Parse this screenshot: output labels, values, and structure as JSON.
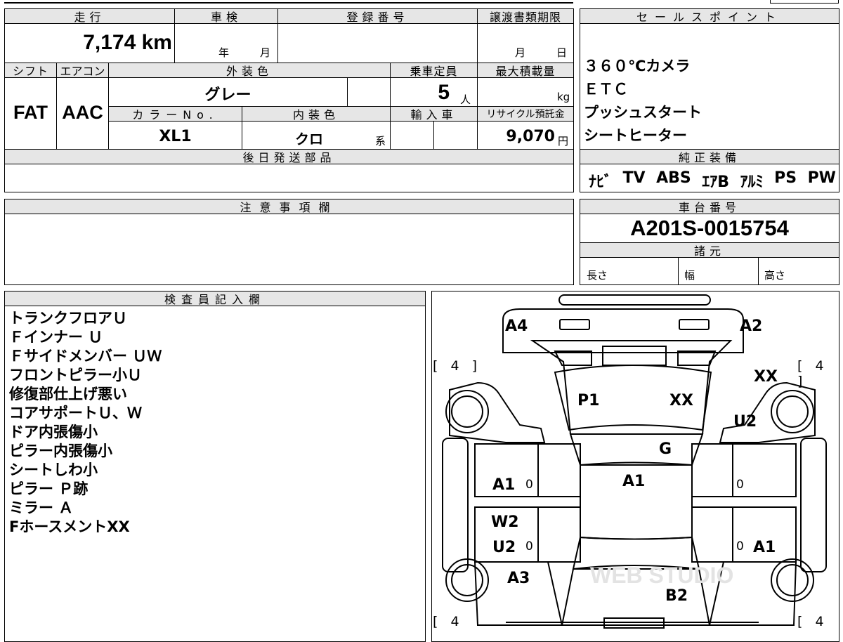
{
  "header": {
    "mileage_label": "走行",
    "inspection_label": "車検",
    "registration_label": "登録番号",
    "transfer_deadline_label": "譲渡書類期限",
    "sales_points_label": "セールスポイント"
  },
  "values": {
    "mileage": "7,174 km",
    "year_unit": "年",
    "month_unit": "月",
    "deadline_month": "月",
    "deadline_day": "日"
  },
  "labels": {
    "shift": "シフト",
    "aircon": "エアコン",
    "exterior_color": "外装色",
    "capacity": "乗車定員",
    "max_load": "最大積載量",
    "color_no": "カラーNo.",
    "interior_color": "内装色",
    "import": "輸入車",
    "recycle": "リサイクル預託金",
    "later_parts": "後日発送部品",
    "equipment": "純正装備",
    "notes": "注意事項欄",
    "chassis_no": "車台番号",
    "specs": "諸元",
    "length": "長さ",
    "width": "幅",
    "height": "高さ",
    "inspector": "検査員記入欄"
  },
  "specs_values": {
    "shift": "FAT",
    "aircon": "AAC",
    "exterior_color": "グレー",
    "capacity": "5",
    "capacity_unit": "人",
    "load_unit": "kg",
    "color_no": "XL1",
    "interior_color": "クロ",
    "interior_suffix": "系",
    "recycle_fee": "9,070",
    "recycle_unit": "円",
    "chassis_no": "A201S-0015754"
  },
  "sales_points": [
    "３６０℃カメラ",
    "ＥＴＣ",
    "プッシュスタート",
    "シートヒーター"
  ],
  "equipment": [
    "ﾅﾋﾞ",
    "TV",
    "ABS",
    "ｴｱB",
    "ｱﾙﾐ",
    "PS",
    "PW"
  ],
  "inspector_notes": [
    "トランクフロアＵ",
    "Ｆインナー Ｕ",
    "Ｆサイドメンバー ＵＷ",
    "フロントピラー小Ｕ",
    "修復部仕上げ悪い",
    "コアサポートＵ、Ｗ",
    "ドア内張傷小",
    "ピラー内張傷小",
    "シートしわ小",
    "ピラー Ｐ跡",
    "ミラー Ａ",
    "FホースメントXX"
  ],
  "diagram": {
    "tire_left_top": "[ 4 ]",
    "tire_right_top": "[ 4 ]",
    "tire_left_bottom": "[ 4",
    "tire_right_bottom": "[ 4",
    "a4": "A4",
    "a2": "A2",
    "xx_top_right": "XX",
    "p1": "P1",
    "xx_mid": "XX",
    "u2_right": "U2",
    "g": "G",
    "a1_left": "A1",
    "zero_left_top": "0",
    "a1_center": "A1",
    "zero_right_top": "0",
    "w2": "W2",
    "u2_left": "U2",
    "zero_left_bottom": "0",
    "zero_right_bottom": "0",
    "a1_right": "A1",
    "a3": "A3",
    "b2": "B2"
  }
}
